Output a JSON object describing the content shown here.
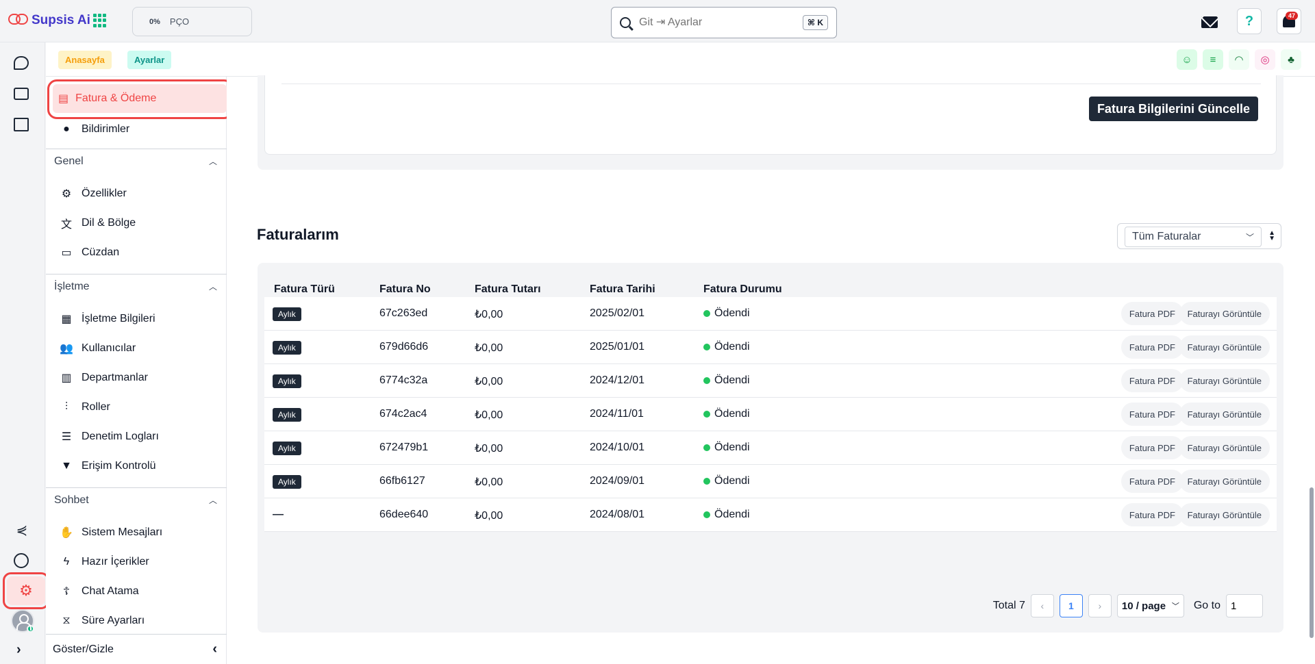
{
  "topbar": {
    "app_name": "Supsis Ai",
    "progress_percent": "0%",
    "progress_label": "PÇO",
    "search_placeholder": "Git ⇥ Ayarlar",
    "search_shortcut": "⌘ K",
    "help_label": "?",
    "notification_count": "47"
  },
  "breadcrumb": {
    "home": "Anasayfa",
    "current": "Ayarlar"
  },
  "sidebar": {
    "active_item": "Fatura & Ödeme",
    "top_items": [
      "Bildirimler"
    ],
    "sections": [
      {
        "title": "Genel",
        "items": [
          "Özellikler",
          "Dil & Bölge",
          "Cüzdan"
        ]
      },
      {
        "title": "İşletme",
        "items": [
          "İşletme Bilgileri",
          "Kullanıcılar",
          "Departmanlar",
          "Roller",
          "Denetim Logları",
          "Erişim Kontrolü"
        ]
      },
      {
        "title": "Sohbet",
        "items": [
          "Sistem Mesajları",
          "Hazır İçerikler",
          "Chat Atama",
          "Süre Ayarları"
        ]
      }
    ],
    "footer_label": "Göster/Gizle"
  },
  "billing": {
    "update_button": "Fatura Bilgilerini Güncelle"
  },
  "invoices": {
    "title": "Faturalarım",
    "filter_value": "Tüm Faturalar",
    "columns": [
      "Fatura Türü",
      "Fatura No",
      "Fatura Tutarı",
      "Fatura Tarihi",
      "Fatura Durumu"
    ],
    "pdf_label": "Fatura PDF",
    "view_label": "Faturayı Görüntüle",
    "rows": [
      {
        "type": "Aylık",
        "no": "67c263ed",
        "amount": "₺0,00",
        "date": "2025/02/01",
        "status": "Ödendi"
      },
      {
        "type": "Aylık",
        "no": "679d66d6",
        "amount": "₺0,00",
        "date": "2025/01/01",
        "status": "Ödendi"
      },
      {
        "type": "Aylık",
        "no": "6774c32a",
        "amount": "₺0,00",
        "date": "2024/12/01",
        "status": "Ödendi"
      },
      {
        "type": "Aylık",
        "no": "674c2ac4",
        "amount": "₺0,00",
        "date": "2024/11/01",
        "status": "Ödendi"
      },
      {
        "type": "Aylık",
        "no": "672479b1",
        "amount": "₺0,00",
        "date": "2024/10/01",
        "status": "Ödendi"
      },
      {
        "type": "Aylık",
        "no": "66fb6127",
        "amount": "₺0,00",
        "date": "2024/09/01",
        "status": "Ödendi"
      },
      {
        "type": "—",
        "no": "66dee640",
        "amount": "₺0,00",
        "date": "2024/08/01",
        "status": "Ödendi"
      }
    ],
    "pagination": {
      "total_label": "Total 7",
      "current_page": "1",
      "page_size": "10 / page",
      "goto_label": "Go to",
      "goto_value": "1"
    }
  },
  "colors": {
    "accent_red": "#ef4444",
    "status_green": "#22c55e",
    "brand_indigo": "#4338ca"
  }
}
